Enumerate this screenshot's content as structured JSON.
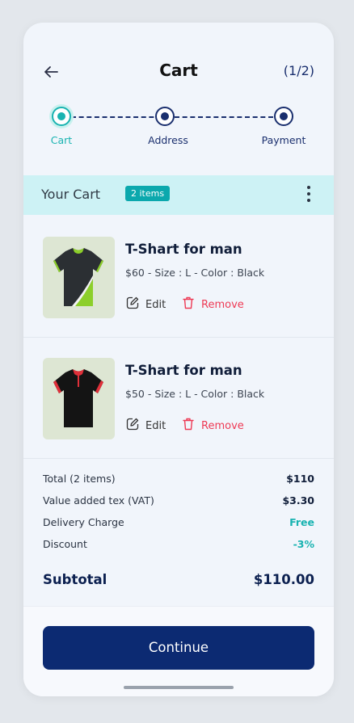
{
  "header": {
    "title": "Cart",
    "step_count": "(1/2)"
  },
  "stepper": {
    "steps": [
      {
        "label": "Cart",
        "active": true
      },
      {
        "label": "Address",
        "active": false
      },
      {
        "label": "Payment",
        "active": false
      }
    ]
  },
  "cart_bar": {
    "title": "Your Cart",
    "badge": "2 items"
  },
  "items": [
    {
      "name": "T-Shart for man",
      "meta": "$60 - Size : L - Color : Black",
      "edit_label": "Edit",
      "remove_label": "Remove"
    },
    {
      "name": "T-Shart for man",
      "meta": "$50 - Size : L - Color : Black",
      "edit_label": "Edit",
      "remove_label": "Remove"
    }
  ],
  "summary": {
    "rows": [
      {
        "label": "Total (2 items)",
        "value": "$110"
      },
      {
        "label": "Value added tex (VAT)",
        "value": "$3.30"
      },
      {
        "label": "Delivery Charge",
        "value": "Free"
      },
      {
        "label": "Discount",
        "value": "-3%"
      }
    ],
    "subtotal_label": "Subtotal",
    "subtotal_value": "$110.00"
  },
  "footer": {
    "continue_label": "Continue"
  },
  "colors": {
    "primary": "#0c2a72",
    "accent": "#19b3b1",
    "danger": "#ee3a55"
  }
}
